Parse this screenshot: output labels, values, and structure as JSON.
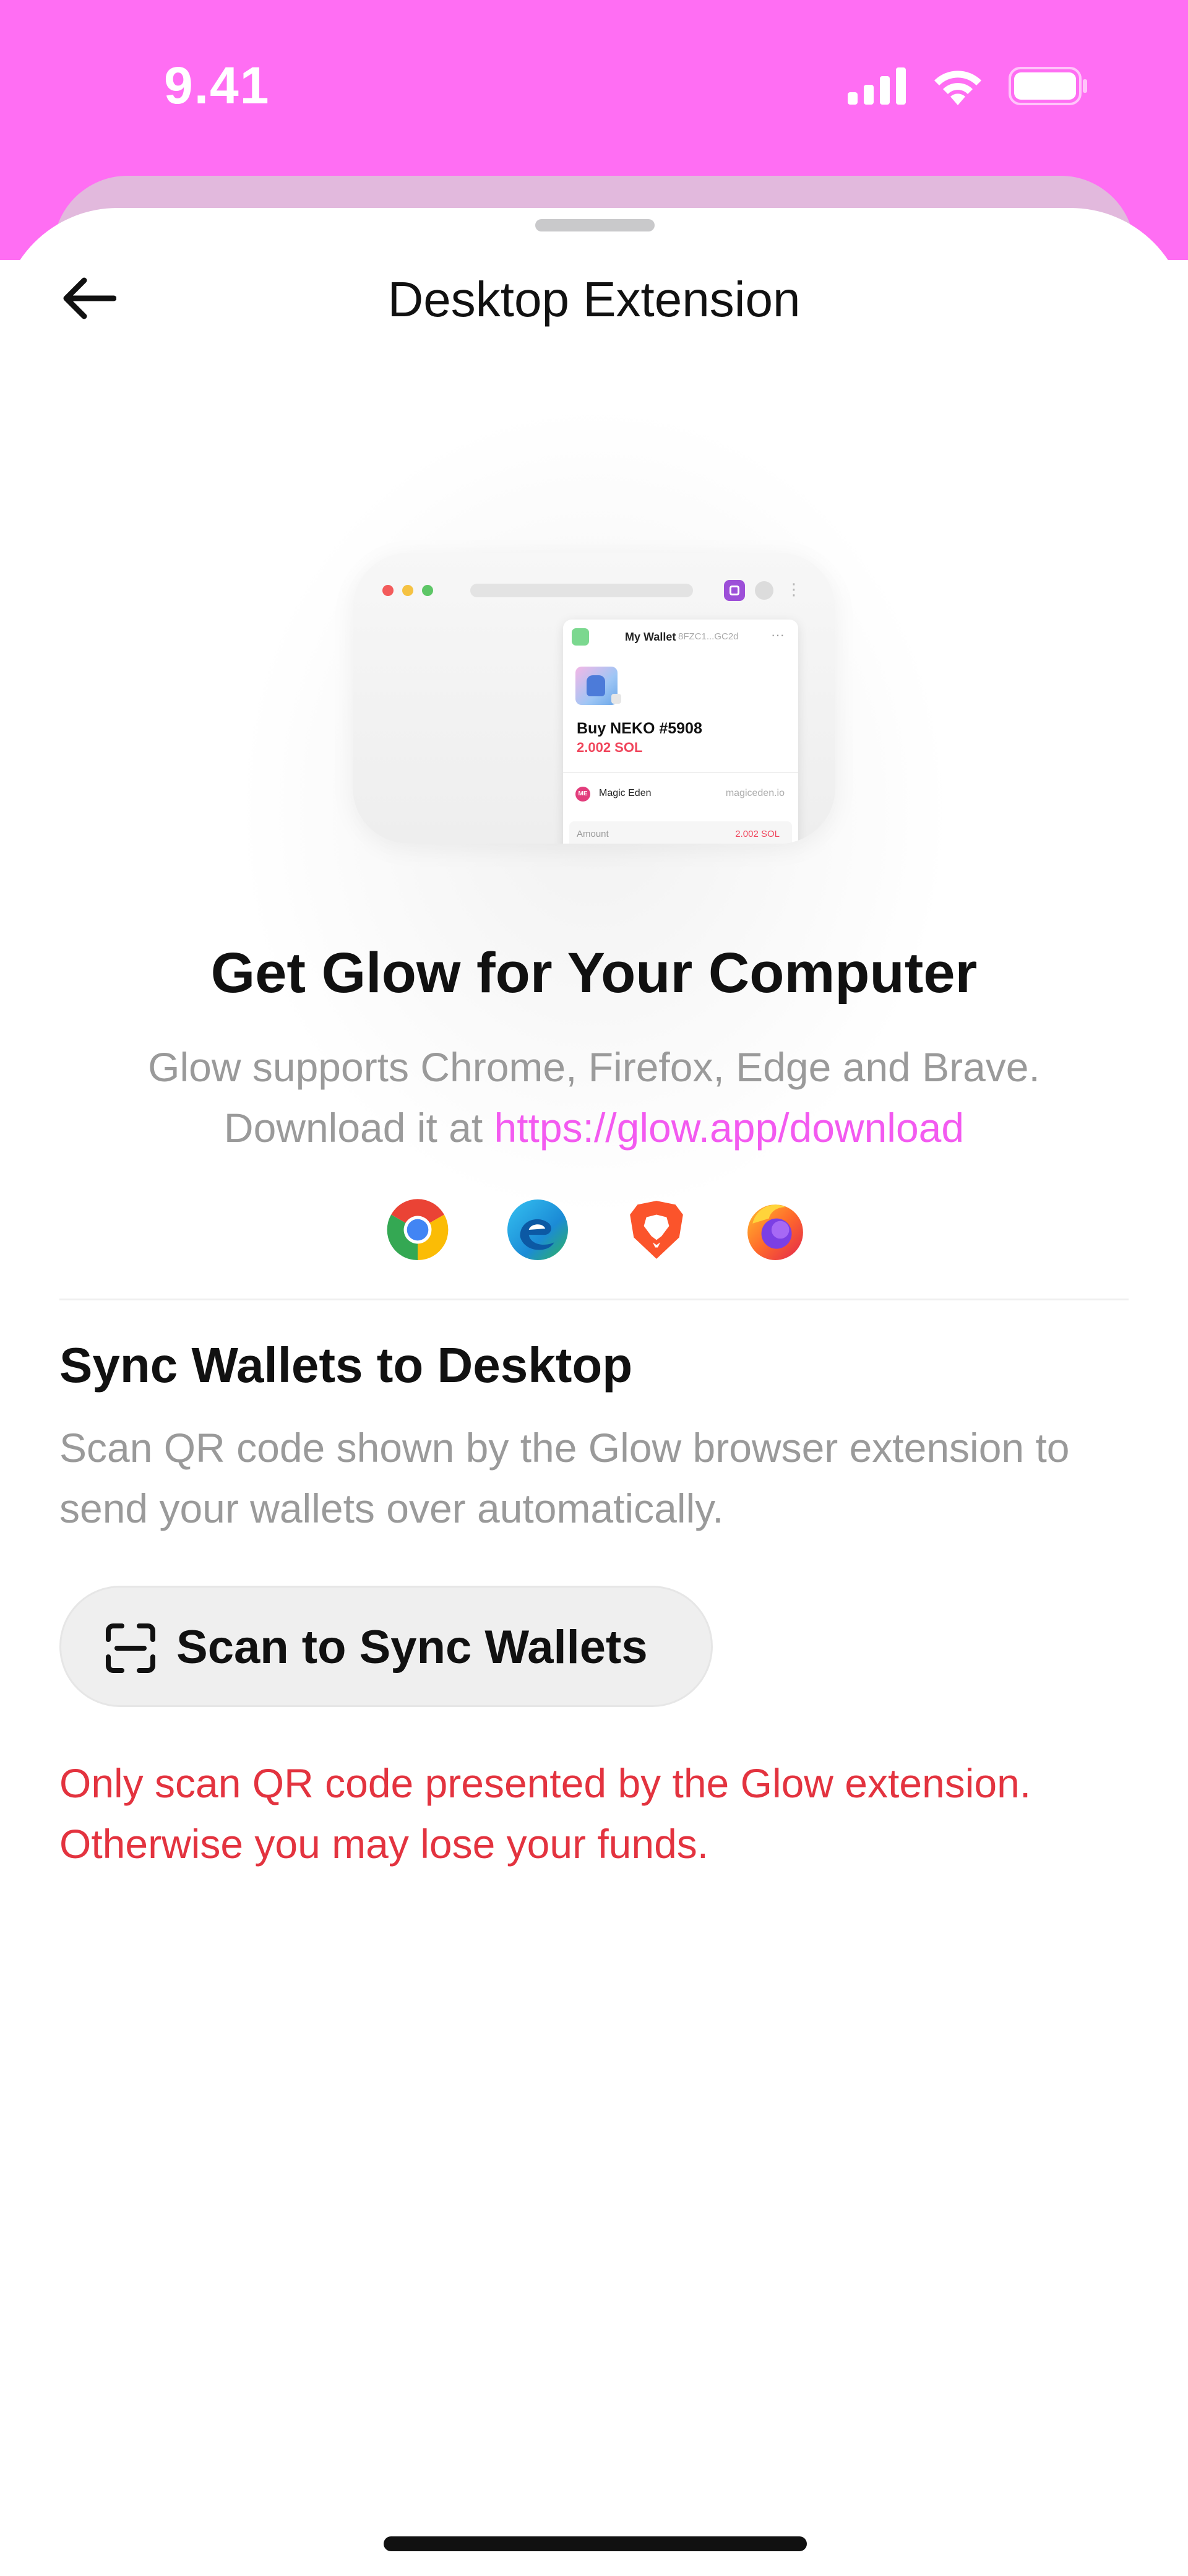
{
  "status_bar": {
    "time": "9.41",
    "icons": [
      "signal-icon",
      "wifi-icon",
      "battery-icon"
    ]
  },
  "header": {
    "title": "Desktop Extension",
    "back_icon": "arrow-left-icon"
  },
  "illustration": {
    "wallet_title": "My Wallet",
    "wallet_address": "8FZC1...GC2d",
    "nft_name": "Buy NEKO #5908",
    "nft_price": "2.002 SOL",
    "marketplace": "Magic Eden",
    "marketplace_badge": "ME",
    "marketplace_site": "magiceden.io",
    "amount_label": "Amount",
    "amount_value": "2.002 SOL",
    "more_glyph": "···"
  },
  "hero": {
    "title": "Get Glow for Your Computer",
    "desc_line1": "Glow supports Chrome, Firefox, Edge and Brave.",
    "desc_prefix": "Download it at",
    "link": "https://glow.app/download"
  },
  "browsers": [
    "chrome-icon",
    "edge-icon",
    "brave-icon",
    "firefox-icon"
  ],
  "sync": {
    "title": "Sync Wallets to Desktop",
    "desc": "Scan QR code shown by the Glow browser extension to send your wallets over automatically.",
    "button_label": "Scan to Sync Wallets"
  },
  "warning": {
    "text": "Only scan QR code presented by the Glow extension. Otherwise you may lose your funds."
  },
  "colors": {
    "brand_pink": "#FF6EF3",
    "link_pink": "#F35AF0",
    "warning_red": "#E3333F",
    "muted_text": "#9A9A9A"
  }
}
